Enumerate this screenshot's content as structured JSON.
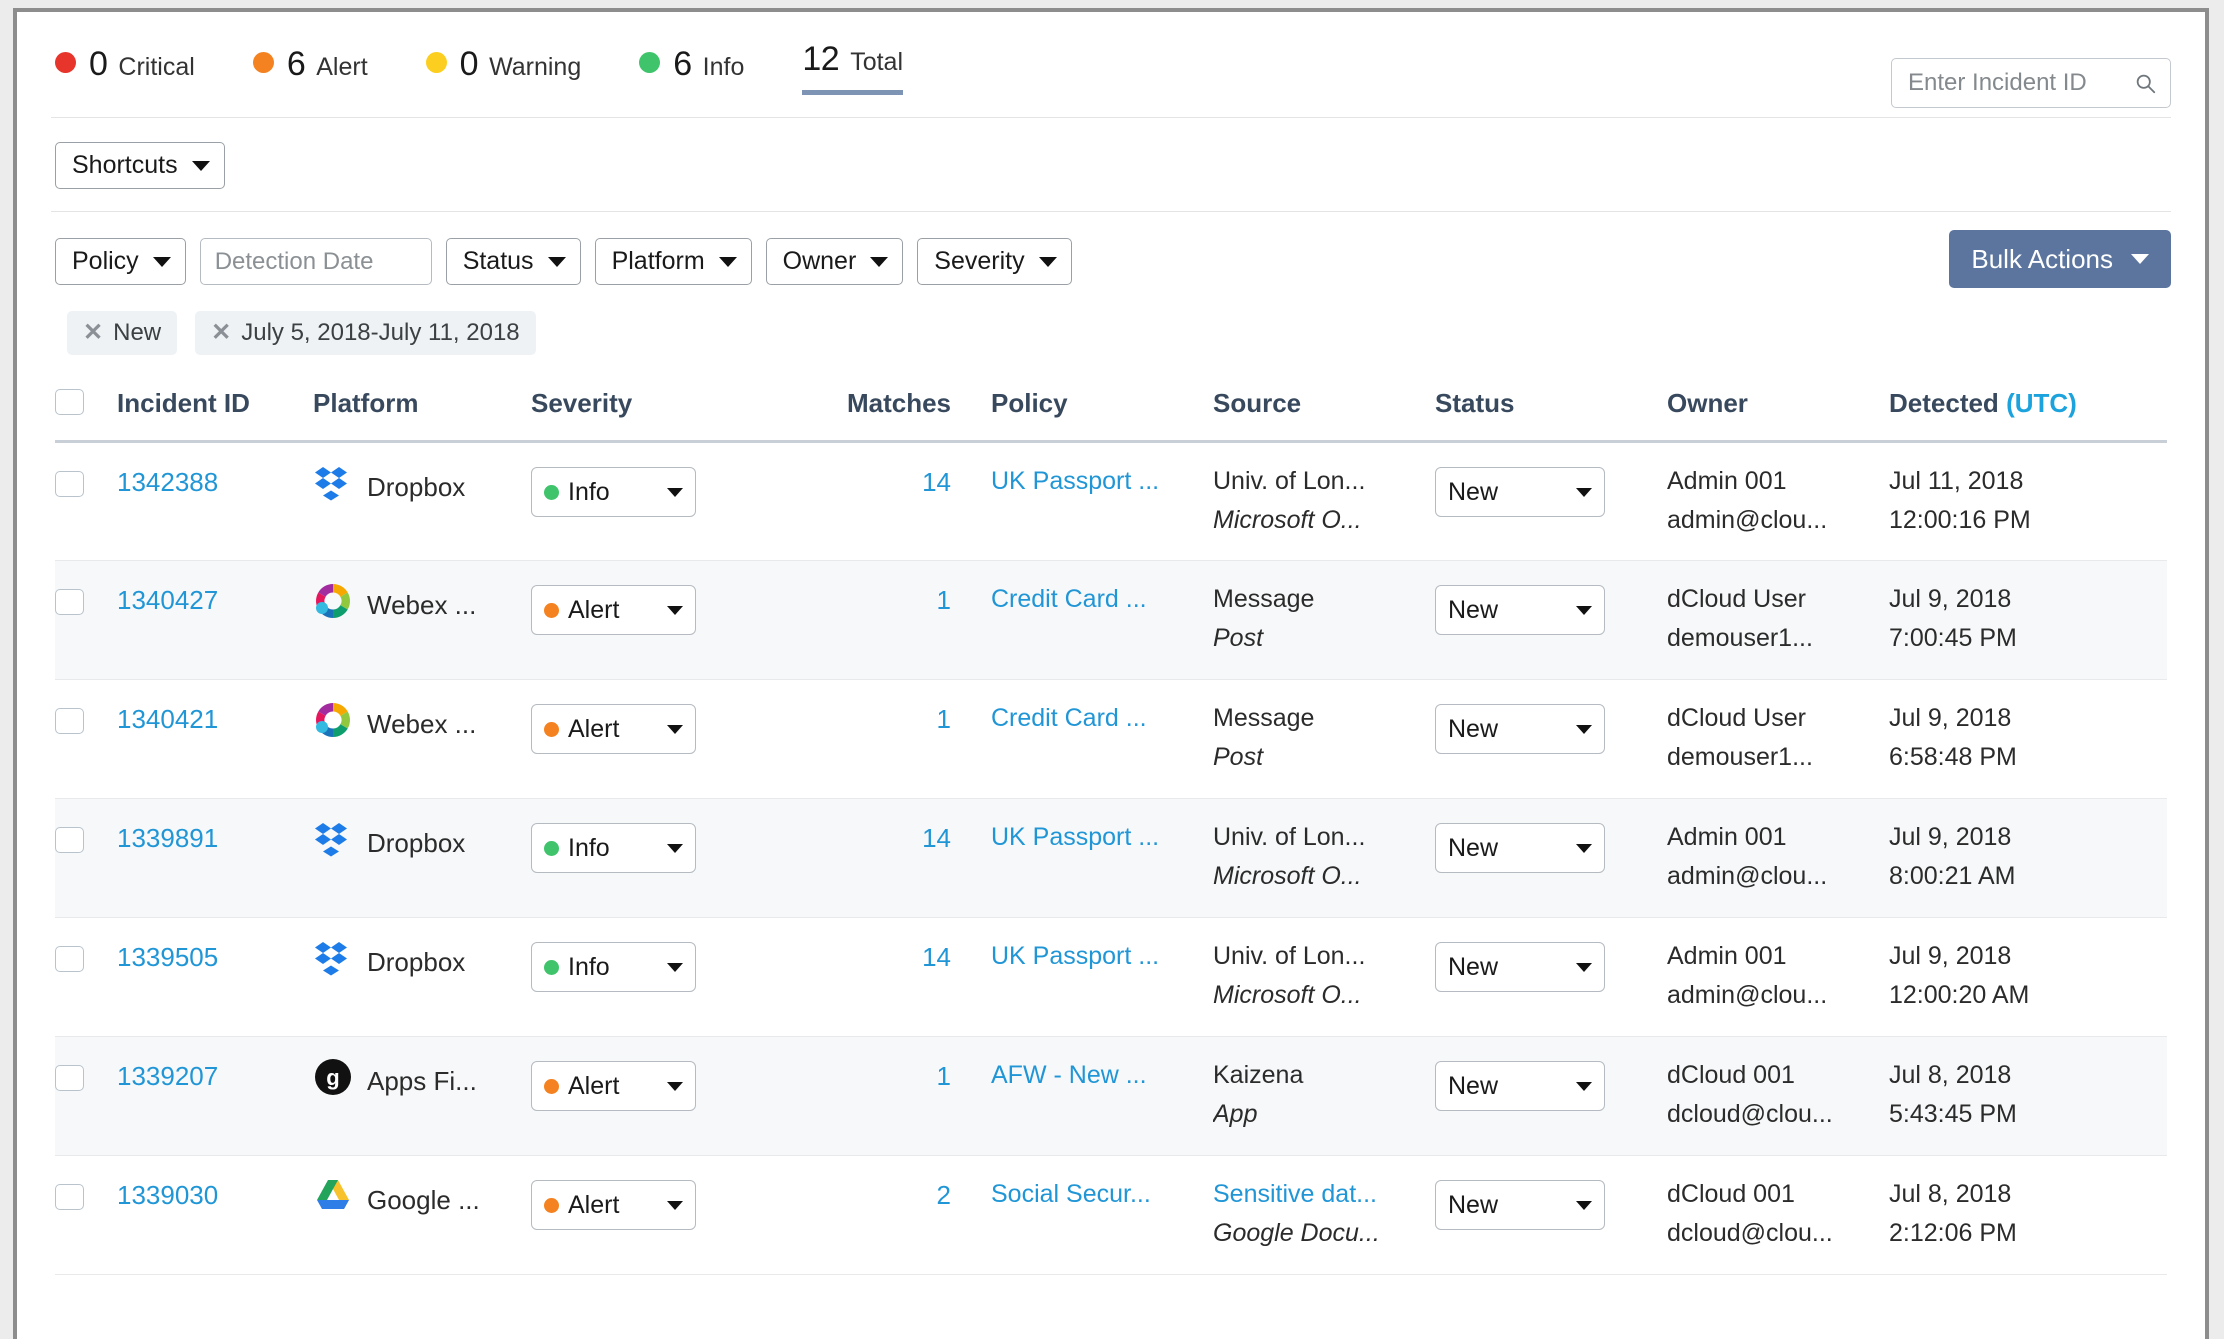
{
  "summary": {
    "items": [
      {
        "count": "0",
        "label": "Critical",
        "color": "#e8352c"
      },
      {
        "count": "6",
        "label": "Alert",
        "color": "#f58220"
      },
      {
        "count": "0",
        "label": "Warning",
        "color": "#fbce1f"
      },
      {
        "count": "6",
        "label": "Info",
        "color": "#3fc46b"
      }
    ],
    "total": {
      "count": "12",
      "label": "Total",
      "underline_color": "#7e94b5"
    }
  },
  "search": {
    "placeholder": "Enter Incident ID",
    "value": "",
    "icon": "search-icon"
  },
  "shortcuts": {
    "label": "Shortcuts"
  },
  "filters": {
    "policy": "Policy",
    "detection_date_placeholder": "Detection Date",
    "detection_date_value": "",
    "status": "Status",
    "platform": "Platform",
    "owner": "Owner",
    "severity": "Severity",
    "bulk_actions": "Bulk Actions",
    "bulk_actions_color": "#5b759e"
  },
  "chips": [
    {
      "remove_icon": "close-icon",
      "label": "New"
    },
    {
      "remove_icon": "close-icon",
      "label": "July 5, 2018-July 11, 2018"
    }
  ],
  "table": {
    "headers": {
      "incident_id": "Incident ID",
      "platform": "Platform",
      "severity": "Severity",
      "matches": "Matches",
      "policy": "Policy",
      "source": "Source",
      "status": "Status",
      "owner": "Owner",
      "detected": "Detected",
      "detected_tz": "(UTC)"
    },
    "rows": [
      {
        "incident_id": "1342388",
        "platform": "Dropbox",
        "platform_icon": "dropbox-icon",
        "severity": "Info",
        "severity_color": "#3fc46b",
        "matches": "14",
        "policy": "UK Passport ...",
        "source_primary": "Univ. of Lon...",
        "source_primary_link": false,
        "source_secondary": "Microsoft O...",
        "status": "New",
        "owner_name": "Admin 001",
        "owner_email": "admin@clou...",
        "detected_date": "Jul 11, 2018",
        "detected_time": "12:00:16 PM"
      },
      {
        "incident_id": "1340427",
        "platform": "Webex ...",
        "platform_icon": "webex-icon",
        "severity": "Alert",
        "severity_color": "#f58220",
        "matches": "1",
        "policy": "Credit Card ...",
        "source_primary": "Message",
        "source_primary_link": false,
        "source_secondary": "Post",
        "status": "New",
        "owner_name": "dCloud User",
        "owner_email": "demouser1...",
        "detected_date": "Jul 9, 2018",
        "detected_time": "7:00:45 PM"
      },
      {
        "incident_id": "1340421",
        "platform": "Webex ...",
        "platform_icon": "webex-icon",
        "severity": "Alert",
        "severity_color": "#f58220",
        "matches": "1",
        "policy": "Credit Card ...",
        "source_primary": "Message",
        "source_primary_link": false,
        "source_secondary": "Post",
        "status": "New",
        "owner_name": "dCloud User",
        "owner_email": "demouser1...",
        "detected_date": "Jul 9, 2018",
        "detected_time": "6:58:48 PM"
      },
      {
        "incident_id": "1339891",
        "platform": "Dropbox",
        "platform_icon": "dropbox-icon",
        "severity": "Info",
        "severity_color": "#3fc46b",
        "matches": "14",
        "policy": "UK Passport ...",
        "source_primary": "Univ. of Lon...",
        "source_primary_link": false,
        "source_secondary": "Microsoft O...",
        "status": "New",
        "owner_name": "Admin 001",
        "owner_email": "admin@clou...",
        "detected_date": "Jul 9, 2018",
        "detected_time": "8:00:21 AM"
      },
      {
        "incident_id": "1339505",
        "platform": "Dropbox",
        "platform_icon": "dropbox-icon",
        "severity": "Info",
        "severity_color": "#3fc46b",
        "matches": "14",
        "policy": "UK Passport ...",
        "source_primary": "Univ. of Lon...",
        "source_primary_link": false,
        "source_secondary": "Microsoft O...",
        "status": "New",
        "owner_name": "Admin 001",
        "owner_email": "admin@clou...",
        "detected_date": "Jul 9, 2018",
        "detected_time": "12:00:20 AM"
      },
      {
        "incident_id": "1339207",
        "platform": "Apps Fi...",
        "platform_icon": "apps-file-icon",
        "severity": "Alert",
        "severity_color": "#f58220",
        "matches": "1",
        "policy": "AFW - New ...",
        "source_primary": "Kaizena",
        "source_primary_link": false,
        "source_secondary": "App",
        "status": "New",
        "owner_name": "dCloud 001",
        "owner_email": "dcloud@clou...",
        "detected_date": "Jul 8, 2018",
        "detected_time": "5:43:45 PM"
      },
      {
        "incident_id": "1339030",
        "platform": "Google ...",
        "platform_icon": "google-drive-icon",
        "severity": "Alert",
        "severity_color": "#f58220",
        "matches": "2",
        "policy": "Social Secur...",
        "source_primary": "Sensitive dat...",
        "source_primary_link": true,
        "source_secondary": "Google Docu...",
        "status": "New",
        "owner_name": "dCloud 001",
        "owner_email": "dcloud@clou...",
        "detected_date": "Jul 8, 2018",
        "detected_time": "2:12:06 PM"
      }
    ]
  }
}
